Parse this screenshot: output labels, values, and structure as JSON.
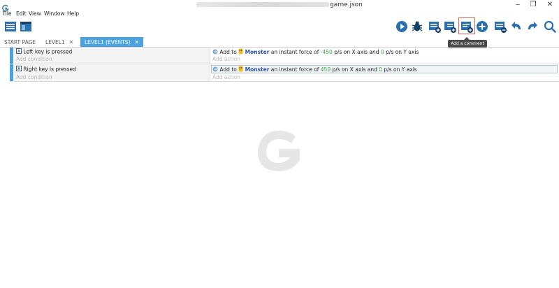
{
  "window": {
    "title_suffix": "game.json",
    "controls": {
      "minimize": "‒",
      "restore": "❐",
      "close": "✕"
    }
  },
  "menu": [
    "File",
    "Edit",
    "View",
    "Window",
    "Help"
  ],
  "toolbar": {
    "tooltip": "Add a comment"
  },
  "tabs": [
    {
      "label": "START PAGE",
      "active": false,
      "closable": false
    },
    {
      "label": "LEVEL1",
      "active": false,
      "closable": true
    },
    {
      "label": "LEVEL1 (EVENTS)",
      "active": true,
      "closable": true
    }
  ],
  "tab_close_glyph": "✕",
  "events": [
    {
      "condition": "Left key is pressed",
      "add_condition": "Add condition",
      "action": {
        "prefix": "Add to",
        "object": "Monster",
        "mid": "an instant force of",
        "x_value": "-450",
        "x_text": "p/s on X axis and",
        "y_value": "0",
        "y_text": "p/s on Y axis"
      },
      "add_action": "Add action"
    },
    {
      "condition": "Right key is pressed",
      "add_condition": "Add condition",
      "action": {
        "prefix": "Add to",
        "object": "Monster",
        "mid": "an instant force of",
        "x_value": "450",
        "x_text": "p/s on X axis and",
        "y_value": "0",
        "y_text": "p/s on Y axis"
      },
      "add_action": "Add action"
    }
  ],
  "colors": {
    "accent": "#4aa3df",
    "highlight_border": "#e0605a",
    "number_green": "#3aa642",
    "object_blue": "#2b4fa2"
  }
}
